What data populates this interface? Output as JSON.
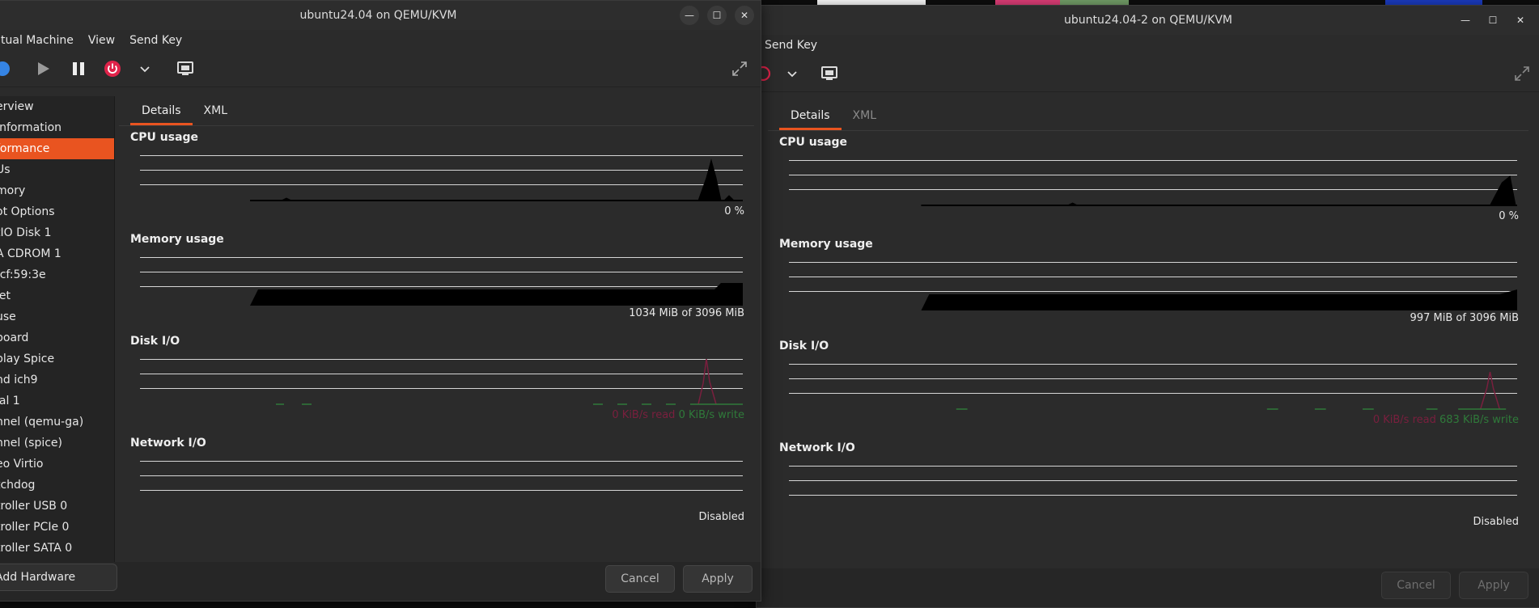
{
  "desktop": {
    "thumb_colors": [
      "#ffffff",
      "#e33f7a",
      "#76a26a",
      "#1b3cc4"
    ]
  },
  "win1": {
    "title": "ubuntu24.04 on QEMU/KVM",
    "menu": [
      "tual Machine",
      "View",
      "Send Key"
    ],
    "sidebar": [
      "erview",
      "Information",
      "formance",
      "Us",
      "mory",
      "ot Options",
      "tIO Disk 1",
      "A CDROM 1",
      ":cf:59:3e",
      "let",
      "use",
      "board",
      "play Spice",
      "nd ich9",
      "ial 1",
      "nnel (qemu-ga)",
      "nnel (spice)",
      "eo Virtio",
      "tchdog",
      "troller USB 0",
      "troller PCIe 0",
      "troller SATA 0"
    ],
    "add_hardware": "Add Hardware",
    "tabs": [
      "Details",
      "XML"
    ],
    "cpu_title": "CPU usage",
    "cpu_value": "0 %",
    "mem_title": "Memory usage",
    "mem_value": "1034 MiB of 3096 MiB",
    "disk_title": "Disk I/O",
    "disk_read": "0 KiB/s read",
    "disk_write": "0 KiB/s write",
    "net_title": "Network I/O",
    "net_value": "Disabled",
    "cancel": "Cancel",
    "apply": "Apply"
  },
  "win2": {
    "title": "ubuntu24.04-2 on QEMU/KVM",
    "menu": [
      "Send Key"
    ],
    "tabs": [
      "Details",
      "XML"
    ],
    "cpu_title": "CPU usage",
    "cpu_value": "0 %",
    "mem_title": "Memory usage",
    "mem_value": "997 MiB of 3096 MiB",
    "disk_title": "Disk I/O",
    "disk_read": "0 KiB/s read",
    "disk_write": "683 KiB/s write",
    "net_title": "Network I/O",
    "net_value": "Disabled",
    "cancel": "Cancel",
    "apply": "Apply"
  },
  "colors": {
    "accent": "#e95420",
    "read": "#7a1f3e",
    "write": "#2f7a3a"
  }
}
